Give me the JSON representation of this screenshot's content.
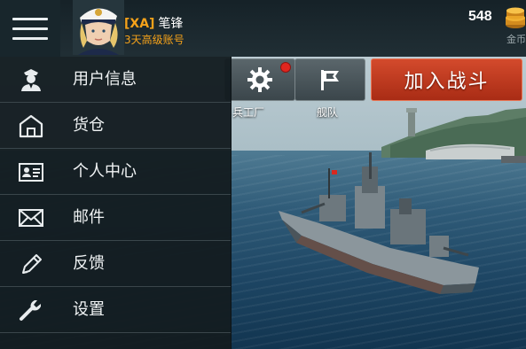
{
  "header": {
    "clan_tag": "[XA]",
    "player_name": "笔锋",
    "account_status": "3天高级账号",
    "gold_amount": "548",
    "gold_label": "金币"
  },
  "actions": {
    "workshop_caption": "兵工厂",
    "fleet_caption": "舰队",
    "battle_label": "加入战斗"
  },
  "menu": {
    "items": [
      {
        "label": "用户信息",
        "icon": "user-icon"
      },
      {
        "label": "货仓",
        "icon": "warehouse-icon"
      },
      {
        "label": "个人中心",
        "icon": "id-card-icon"
      },
      {
        "label": "邮件",
        "icon": "mail-icon"
      },
      {
        "label": "反馈",
        "icon": "pencil-icon"
      },
      {
        "label": "设置",
        "icon": "wrench-icon"
      }
    ]
  },
  "colors": {
    "accent_orange": "#f5a21a",
    "battle_red": "#c13a20",
    "notification_red": "#e0261f",
    "menu_bg": "#141d21"
  }
}
